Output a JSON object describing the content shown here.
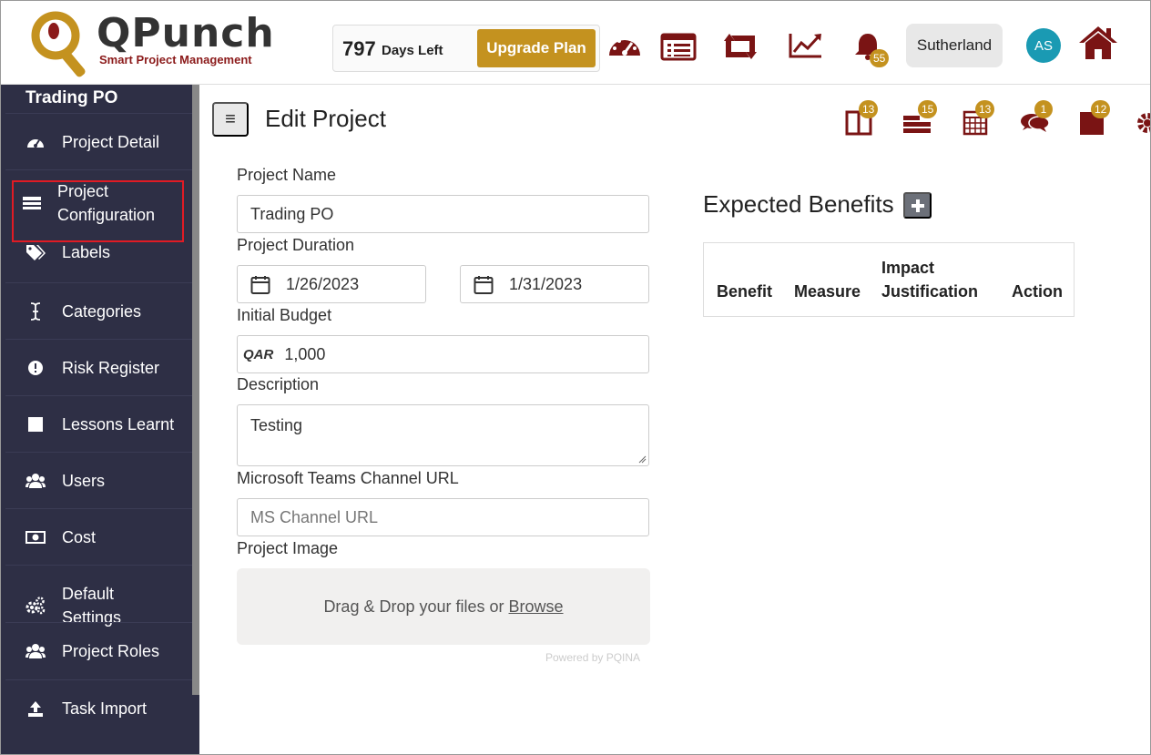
{
  "header": {
    "logo_title": "QPunch",
    "logo_subtitle": "Smart Project Management",
    "days_count": "797",
    "days_label": "Days Left",
    "upgrade_label": "Upgrade Plan",
    "notifications_badge": "55",
    "user_label": "Sutherland",
    "avatar_initials": "AS",
    "accent_color": "#7a1414",
    "gold_color": "#c4921f"
  },
  "sidebar": {
    "project_name": "Trading PO",
    "items": [
      {
        "label": "Project Detail",
        "icon": "dashboard-icon"
      },
      {
        "label": "Project\nConfiguration",
        "icon": "config-icon"
      },
      {
        "label": "Labels",
        "icon": "tags-icon"
      },
      {
        "label": "Categories",
        "icon": "cursor-icon"
      },
      {
        "label": "Risk Register",
        "icon": "alert-icon"
      },
      {
        "label": "Lessons Learnt",
        "icon": "square-icon"
      },
      {
        "label": "Users",
        "icon": "users-icon"
      },
      {
        "label": "Cost",
        "icon": "money-icon"
      },
      {
        "label": "Default\nSettings",
        "icon": "cogs-icon"
      },
      {
        "label": "Project Roles",
        "icon": "users-icon"
      },
      {
        "label": "Task Import",
        "icon": "upload-icon"
      }
    ]
  },
  "main": {
    "title": "Edit Project",
    "badges": [
      "13",
      "15",
      "13",
      "1",
      "12"
    ],
    "project_name_label": "Project Name",
    "project_name_value": "Trading PO",
    "duration_label": "Project Duration",
    "start_date": "1/26/2023",
    "end_date": "1/31/2023",
    "budget_label": "Initial Budget",
    "currency": "QAR",
    "budget_value": "1,000",
    "description_label": "Description",
    "description_value": "Testing",
    "teams_label": "Microsoft Teams Channel URL",
    "teams_placeholder": "MS Channel URL",
    "image_label": "Project Image",
    "dropzone_text": "Drag & Drop your files or",
    "dropzone_browse": "Browse",
    "powered_by": "Powered by PQINA"
  },
  "benefits": {
    "title": "Expected Benefits",
    "columns": [
      "Benefit",
      "Measure",
      "Impact\nJustification",
      "Action"
    ]
  }
}
